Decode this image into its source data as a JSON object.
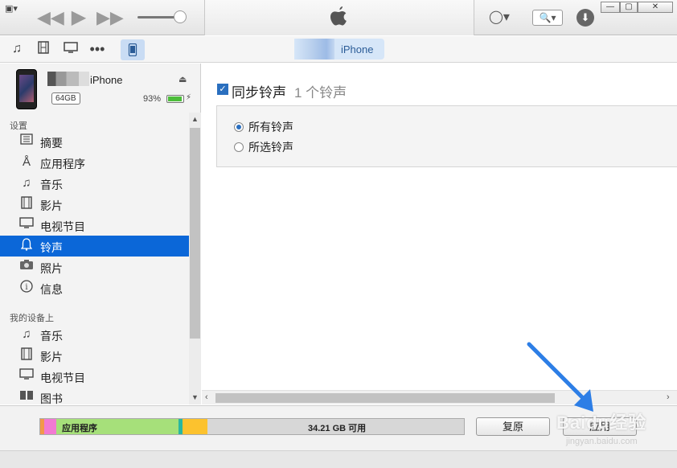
{
  "toolbar": {
    "window_menu": "▣▾",
    "rewind": "◀◀",
    "play": "▶",
    "forward": "▶▶",
    "volume": 0.88,
    "account": "◯▾",
    "search": "🔍▾",
    "download": "⬇",
    "win_minimize": "—",
    "win_restore": "▢",
    "win_close": "✕"
  },
  "navbar": {
    "device_label": "iPhone"
  },
  "sidebar": {
    "device": {
      "name": "iPhone",
      "capacity": "64GB",
      "battery_pct": "93%",
      "battery_level": 0.93
    },
    "settings_head": "设置",
    "settings_items": [
      {
        "label": "摘要",
        "icon": "summary-icon"
      },
      {
        "label": "应用程序",
        "icon": "apps-icon"
      },
      {
        "label": "音乐",
        "icon": "music-icon"
      },
      {
        "label": "影片",
        "icon": "film-icon"
      },
      {
        "label": "电视节目",
        "icon": "tv-icon"
      },
      {
        "label": "铃声",
        "icon": "bell-icon"
      },
      {
        "label": "照片",
        "icon": "camera-icon"
      },
      {
        "label": "信息",
        "icon": "info-icon"
      }
    ],
    "mydevice_head": "我的设备上",
    "mydevice_items": [
      {
        "label": "音乐",
        "icon": "music-icon"
      },
      {
        "label": "影片",
        "icon": "film-icon"
      },
      {
        "label": "电视节目",
        "icon": "tv-icon"
      },
      {
        "label": "图书",
        "icon": "book-icon"
      }
    ]
  },
  "main": {
    "sync_label": "同步铃声",
    "sync_count": "1 个铃声",
    "sync_checked": true,
    "options": [
      {
        "label": "所有铃声",
        "selected": true
      },
      {
        "label": "所选铃声",
        "selected": false
      }
    ]
  },
  "bottom": {
    "apps_label": "应用程序",
    "free_label": "34.21 GB 可用",
    "revert_button": "复原",
    "apply_button": "应用"
  },
  "watermark": {
    "text": "Baidu经验",
    "sub": "jingyan.baidu.com"
  },
  "colors": {
    "accent": "#0b67d8",
    "storage_apps": "#a6e07a",
    "storage_other": "#fcc22e",
    "storage_photos": "#f27ad2",
    "storage_audio": "#f2984a",
    "storage_teal": "#29b7a0",
    "annotation_arrow": "#2d7ee6"
  }
}
